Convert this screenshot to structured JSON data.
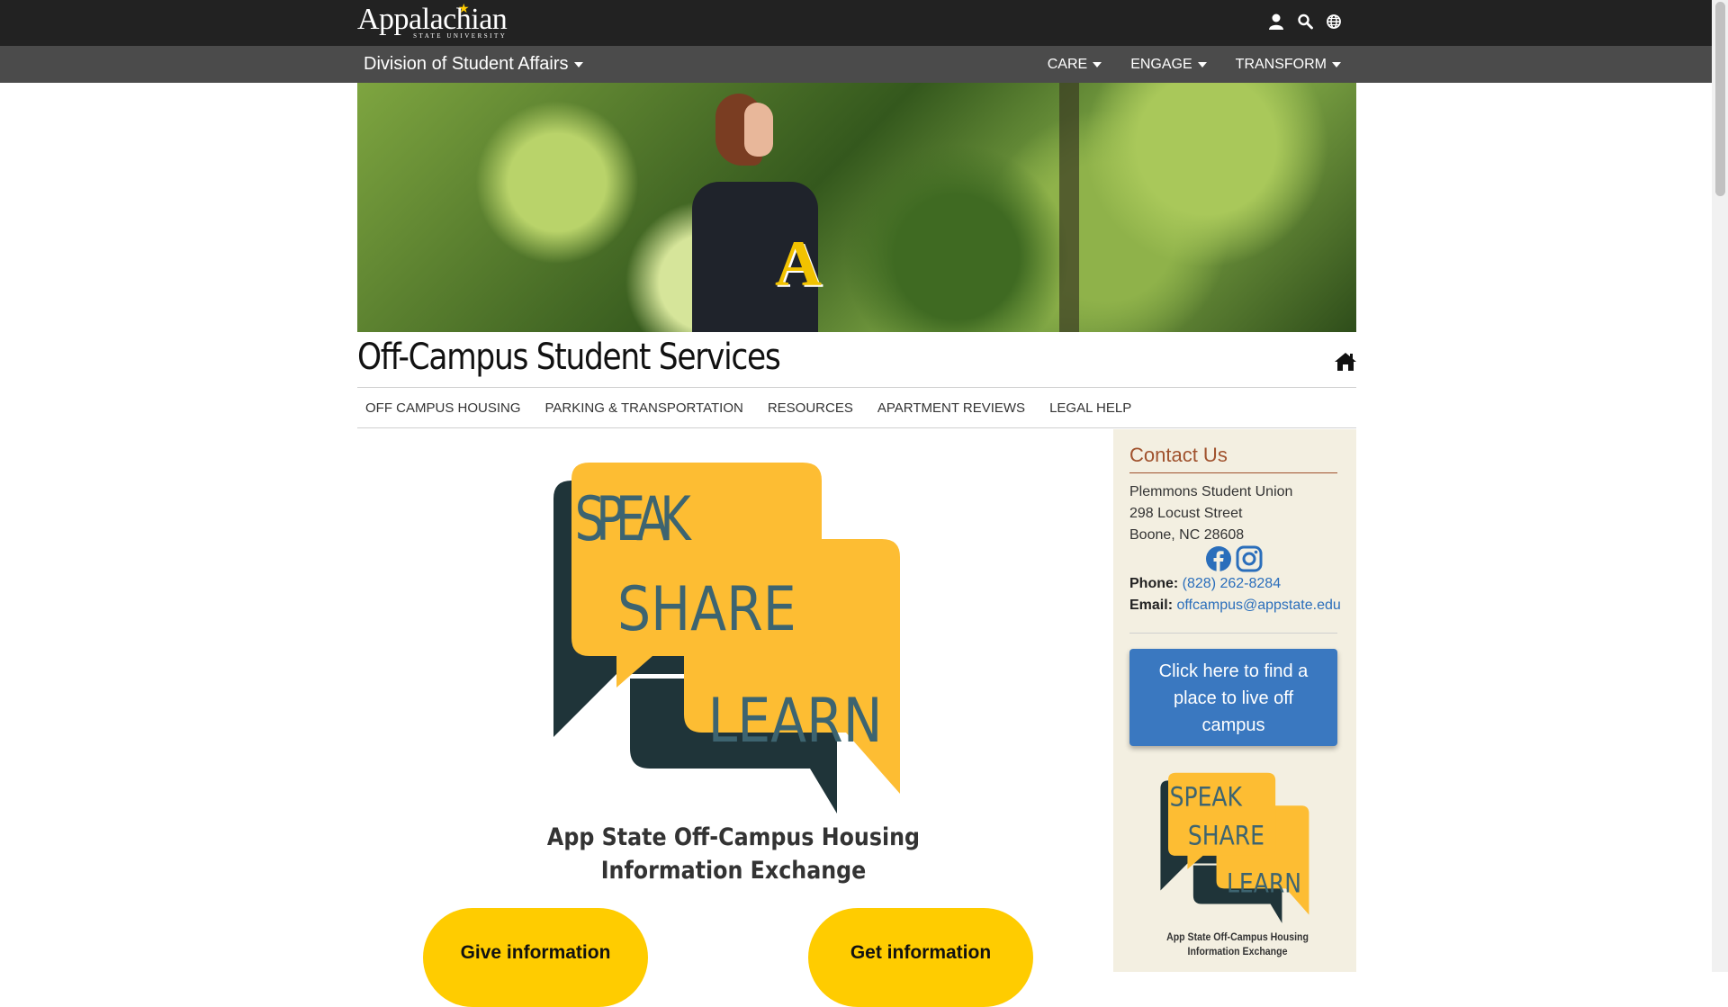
{
  "header": {
    "logo_text": "Appalachian",
    "logo_subtext": "STATE UNIVERSITY",
    "icons": [
      "user-icon",
      "search-icon",
      "globe-icon"
    ]
  },
  "division": {
    "title": "Division of Student Affairs",
    "nav": [
      "CARE",
      "ENGAGE",
      "TRANSFORM"
    ]
  },
  "page": {
    "title": "Off-Campus Student Services"
  },
  "subnav": [
    "OFF CAMPUS HOUSING",
    "PARKING & TRANSPORTATION",
    "RESOURCES",
    "APARTMENT REVIEWS",
    "LEGAL HELP"
  ],
  "main": {
    "logo_words": [
      "SPEAK",
      "SHARE",
      "LEARN"
    ],
    "exchange_title_line1": "App State Off-Campus Housing",
    "exchange_title_line2": "Information Exchange",
    "give_button": "Give information",
    "get_button": "Get information"
  },
  "sidebar": {
    "heading": "Contact Us",
    "address_line1": "Plemmons Student Union",
    "address_line2": "298 Locust Street",
    "address_line3": "Boone, NC 28608",
    "phone_label": "Phone:",
    "phone_value": "(828) 262-8284",
    "email_label": "Email:",
    "email_value": "offcampus@appstate.edu",
    "find_button": "Click here to find a place to live off campus",
    "small_logo_words": [
      "SPEAK",
      "SHARE",
      "LEARN"
    ],
    "small_caption_line1": "App State Off-Campus Housing",
    "small_caption_line2": "Information Exchange"
  },
  "colors": {
    "topbar": "#222222",
    "division_bar": "#4b4b4b",
    "gold": "#ffcc00",
    "bubble_gold": "#fdbd33",
    "bubble_dark": "#1f3439",
    "bubble_text": "#3d6470",
    "sidebar_bg": "#f3efe1",
    "contact_heading": "#a0522d",
    "link": "#2a6ebb",
    "button_blue": "#3a78c0"
  }
}
